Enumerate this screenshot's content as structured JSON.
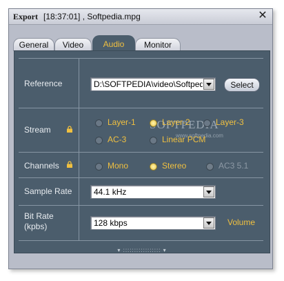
{
  "window": {
    "app_title": "Export",
    "file_title": "[18:37:01] , Softpedia.mpg",
    "close_label": "✕"
  },
  "tabs": [
    {
      "label": "General",
      "active": false
    },
    {
      "label": "Video",
      "active": false
    },
    {
      "label": "Audio",
      "active": true
    },
    {
      "label": "Monitor",
      "active": false
    }
  ],
  "reference": {
    "label": "Reference",
    "path": "D:\\SOFTPEDIA\\video\\Softpedia",
    "select_label": "Select"
  },
  "stream": {
    "label": "Stream",
    "options": [
      {
        "label": "Layer-1",
        "selected": false,
        "disabled": false
      },
      {
        "label": "Layer-2",
        "selected": true,
        "disabled": false
      },
      {
        "label": "Layer-3",
        "selected": false,
        "disabled": false
      },
      {
        "label": "AC-3",
        "selected": false,
        "disabled": false
      },
      {
        "label": "Linear PCM",
        "selected": false,
        "disabled": false
      }
    ]
  },
  "channels": {
    "label": "Channels",
    "options": [
      {
        "label": "Mono",
        "selected": false,
        "disabled": false
      },
      {
        "label": "Stereo",
        "selected": true,
        "disabled": false
      },
      {
        "label": "AC3 5.1",
        "selected": false,
        "disabled": true
      }
    ]
  },
  "sample_rate": {
    "label": "Sample Rate",
    "value": "44.1 kHz"
  },
  "bit_rate": {
    "label_line1": "Bit Rate",
    "label_line2": "(kpbs)",
    "value": "128 kbps",
    "volume_label": "Volume"
  },
  "watermark": {
    "text": "SOFTPEDIA",
    "url": "www.softpedia.com"
  },
  "colors": {
    "panel": "#4b5d6c",
    "accent": "#f0c040",
    "label_text": "#e8ecf0"
  }
}
